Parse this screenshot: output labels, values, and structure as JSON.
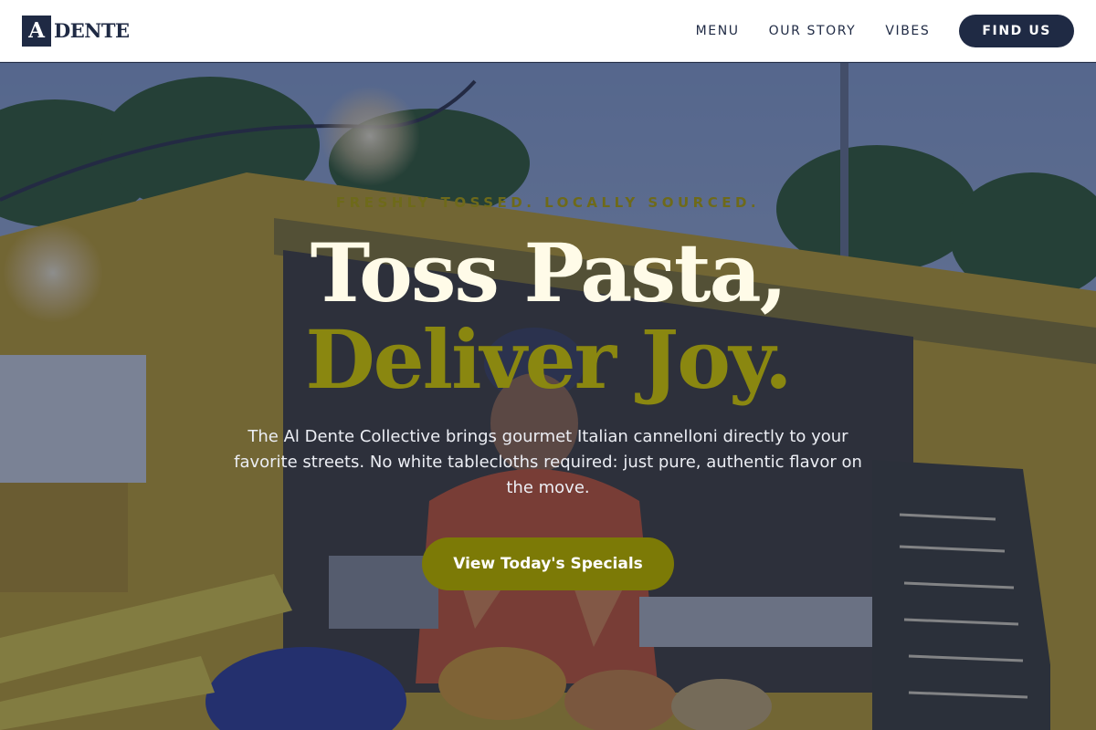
{
  "header": {
    "logo": {
      "mark": "A",
      "word": "DENTE"
    },
    "nav": [
      {
        "label": "MENU"
      },
      {
        "label": "OUR STORY"
      },
      {
        "label": "VIBES"
      }
    ],
    "cta_label": "FIND US"
  },
  "hero": {
    "eyebrow": "FRESHLY TOSSED. LOCALLY SOURCED.",
    "title_line1": "Toss Pasta,",
    "title_line2": "Deliver Joy.",
    "subtitle": "The Al Dente Collective brings gourmet Italian cannelloni directly to your favorite streets. No white tablecloths required: just pure, authentic flavor on the move.",
    "cta_label": "View Today's Specials",
    "background_image": "food-truck-chef-photo"
  },
  "colors": {
    "navy": "#1f2a44",
    "olive_accent": "#8a8710",
    "cta_olive": "#7c7a06",
    "cream": "#fffbe8"
  }
}
